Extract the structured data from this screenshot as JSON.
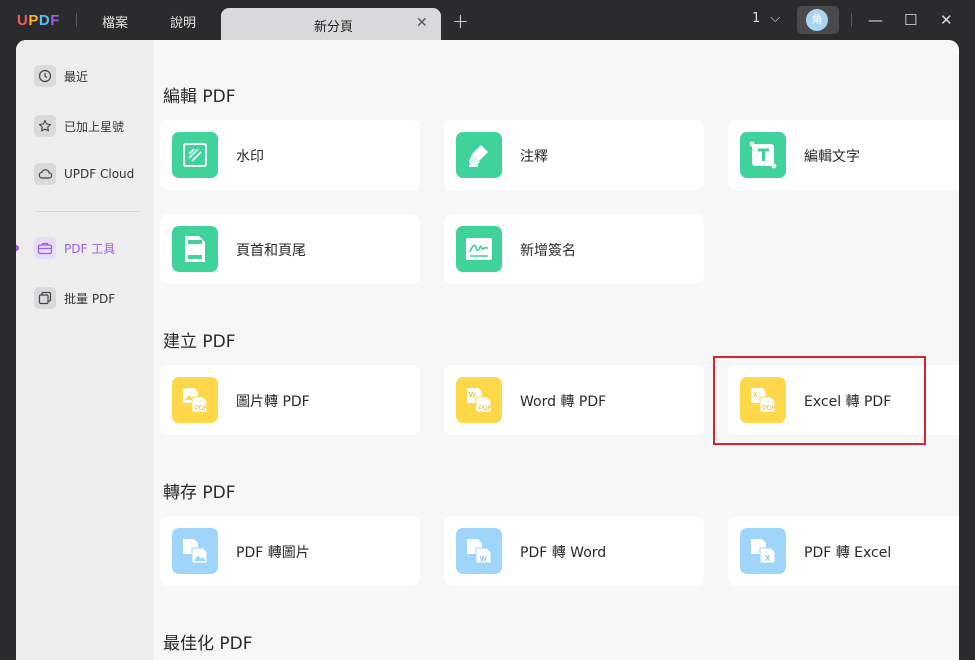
{
  "titlebar": {
    "logo_letters": [
      "U",
      "P",
      "D",
      "F"
    ],
    "logo_colors": [
      "#f25c5c",
      "#ffb31a",
      "#4fc3f7",
      "#9b5de5"
    ],
    "menu": [
      "檔案",
      "說明"
    ],
    "tab_label": "新分頁",
    "tab_close": "✕",
    "new_tab": "+",
    "page_count": "1",
    "page_chevron": "⌵",
    "avatar_char": "角",
    "minimize": "—",
    "maximize": "☐",
    "close": "✕"
  },
  "sidebar": {
    "items": [
      {
        "label": "最近",
        "icon": "clock-icon"
      },
      {
        "label": "已加上星號",
        "icon": "star-icon"
      },
      {
        "label": "UPDF Cloud",
        "icon": "cloud-icon"
      },
      {
        "label": "PDF 工具",
        "icon": "toolbox-icon",
        "active": true
      },
      {
        "label": "批量 PDF",
        "icon": "batch-icon"
      }
    ]
  },
  "sections": [
    {
      "title": "編輯 PDF"
    },
    {
      "title": "建立 PDF"
    },
    {
      "title": "轉存 PDF"
    },
    {
      "title": "最佳化 PDF"
    }
  ],
  "cards": {
    "watermark": "水印",
    "annotate": "注釋",
    "edit_text": "編輯文字",
    "header_footer": "頁首和頁尾",
    "signature": "新增簽名",
    "image_to_pdf": "圖片轉 PDF",
    "word_to_pdf": "Word 轉 PDF",
    "excel_to_pdf": "Excel 轉 PDF",
    "pdf_to_image": "PDF 轉圖片",
    "pdf_to_word": "PDF 轉 Word",
    "pdf_to_excel": "PDF 轉 Excel"
  },
  "colors": {
    "edit_green": "#3fd29a",
    "create_yellow": "#ffd84a",
    "export_blue": "#9fd5fb",
    "active_purple": "#9b5de5",
    "highlight_red": "#d7262e"
  }
}
